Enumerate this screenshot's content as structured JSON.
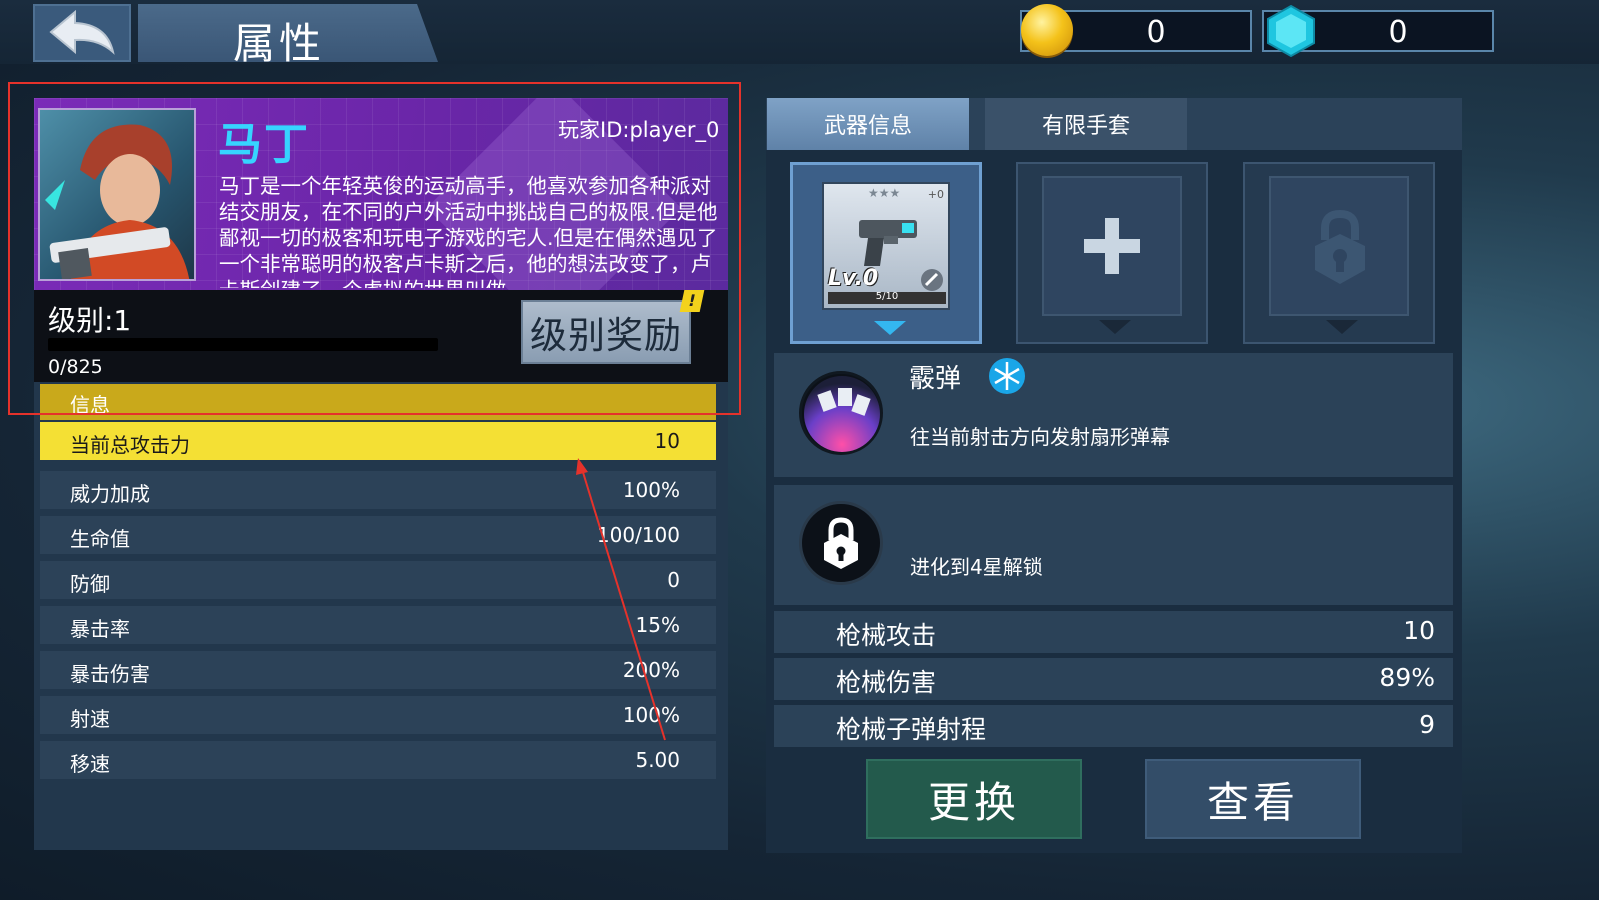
{
  "header": {
    "title": "属性",
    "gold": "0",
    "gems": "0"
  },
  "hero": {
    "name": "马丁",
    "player_id": "玩家ID:player_0",
    "description": "马丁是一个年轻英俊的运动高手，他喜欢参加各种派对结交朋友，在不同的户外活动中挑战自己的极限.但是他鄙视一切的极客和玩电子游戏的宅人.但是在偶然遇见了一个非常聪明的极客卢卡斯之后，他的想法改变了，卢卡斯创建了一个虚拟的世界叫做",
    "level": "级别:1",
    "xp_progress": 0,
    "xp": "0/825",
    "reward_button": "级别奖励",
    "alert": "!"
  },
  "stats": {
    "section_title": "信息",
    "rows": [
      {
        "label": "当前总攻击力",
        "value": "10"
      },
      {
        "label": "威力加成",
        "value": "100%"
      },
      {
        "label": "生命值",
        "value": "100/100"
      },
      {
        "label": "防御",
        "value": "0"
      },
      {
        "label": "暴击率",
        "value": "15%"
      },
      {
        "label": "暴击伤害",
        "value": "200%"
      },
      {
        "label": "射速",
        "value": "100%"
      },
      {
        "label": "移速",
        "value": "5.00"
      }
    ]
  },
  "weapon_panel": {
    "tabs": [
      "武器信息",
      "有限手套"
    ],
    "slot1": {
      "level": "Lv.0",
      "progress": "5/10",
      "plus": "+0",
      "stars": "★★★"
    },
    "slot2_icon": "plus-icon",
    "slot3_icon": "lock-icon",
    "skill1": {
      "name": "霰弹",
      "desc": "往当前射击方向发射扇形弹幕",
      "element_icon": "snowflake-icon"
    },
    "skill2": {
      "desc": "进化到4星解锁",
      "icon": "lock-icon"
    },
    "weapon_stats": [
      {
        "label": "枪械攻击",
        "value": "10"
      },
      {
        "label": "枪械伤害",
        "value": "89%"
      },
      {
        "label": "枪械子弹射程",
        "value": "9"
      }
    ],
    "buttons": {
      "change": "更换",
      "view": "查看"
    }
  },
  "colors": {
    "highlight_row": "#f4e034",
    "info_header": "#c9a91b",
    "hero_name": "#36d4ff",
    "annotation": "#e5322b"
  }
}
